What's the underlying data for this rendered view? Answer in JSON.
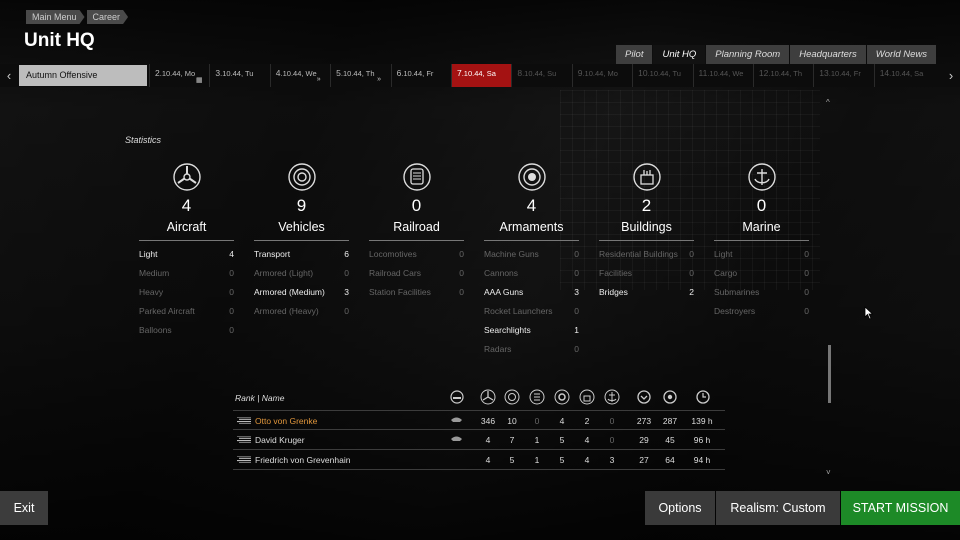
{
  "breadcrumb": [
    "Main Menu",
    "Career"
  ],
  "page_title": "Unit HQ",
  "tabs": [
    "Pilot",
    "Unit HQ",
    "Planning Room",
    "Headquarters",
    "World News"
  ],
  "active_tab": "Unit HQ",
  "timeline": {
    "campaign": "Autumn Offensive",
    "days": [
      {
        "num": "2",
        "label": ".10.44, Mo",
        "state": "normal",
        "glyph": "▦"
      },
      {
        "num": "3",
        "label": ".10.44, Tu",
        "state": "normal",
        "glyph": ""
      },
      {
        "num": "4",
        "label": ".10.44, We",
        "state": "normal",
        "glyph": "»"
      },
      {
        "num": "5",
        "label": ".10.44, Th",
        "state": "normal",
        "glyph": "»"
      },
      {
        "num": "6",
        "label": ".10.44, Fr",
        "state": "normal",
        "glyph": ""
      },
      {
        "num": "7",
        "label": ".10.44, Sa",
        "state": "current",
        "glyph": ""
      },
      {
        "num": "8",
        "label": ".10.44, Su",
        "state": "dim",
        "glyph": ""
      },
      {
        "num": "9",
        "label": ".10.44, Mo",
        "state": "dim",
        "glyph": ""
      },
      {
        "num": "10",
        "label": ".10.44, Tu",
        "state": "dim",
        "glyph": ""
      },
      {
        "num": "11",
        "label": ".10.44, We",
        "state": "dim",
        "glyph": ""
      },
      {
        "num": "12",
        "label": ".10.44, Th",
        "state": "dim",
        "glyph": ""
      },
      {
        "num": "13",
        "label": ".10.44, Fr",
        "state": "dim",
        "glyph": ""
      },
      {
        "num": "14",
        "label": ".10.44, Sa",
        "state": "dim",
        "glyph": ""
      }
    ]
  },
  "statistics": {
    "title": "Statistics",
    "categories": [
      {
        "name": "Aircraft",
        "count": "4",
        "icon": "propeller-icon",
        "rows": [
          {
            "label": "Light",
            "value": "4",
            "on": true
          },
          {
            "label": "Medium",
            "value": "0",
            "on": false
          },
          {
            "label": "Heavy",
            "value": "0",
            "on": false
          },
          {
            "label": "Parked Aircraft",
            "value": "0",
            "on": false
          },
          {
            "label": "Balloons",
            "value": "0",
            "on": false
          }
        ]
      },
      {
        "name": "Vehicles",
        "count": "9",
        "icon": "wheel-icon",
        "rows": [
          {
            "label": "Transport",
            "value": "6",
            "on": true
          },
          {
            "label": "Armored (Light)",
            "value": "0",
            "on": false
          },
          {
            "label": "Armored (Medium)",
            "value": "3",
            "on": true
          },
          {
            "label": "Armored (Heavy)",
            "value": "0",
            "on": false
          }
        ]
      },
      {
        "name": "Railroad",
        "count": "0",
        "icon": "train-icon",
        "rows": [
          {
            "label": "Locomotives",
            "value": "0",
            "on": false
          },
          {
            "label": "Railroad Cars",
            "value": "0",
            "on": false
          },
          {
            "label": "Station Facilities",
            "value": "0",
            "on": false
          }
        ]
      },
      {
        "name": "Armaments",
        "count": "4",
        "icon": "gun-icon",
        "rows": [
          {
            "label": "Machine Guns",
            "value": "0",
            "on": false
          },
          {
            "label": "Cannons",
            "value": "0",
            "on": false
          },
          {
            "label": "AAA Guns",
            "value": "3",
            "on": true
          },
          {
            "label": "Rocket Launchers",
            "value": "0",
            "on": false
          },
          {
            "label": "Searchlights",
            "value": "1",
            "on": true
          },
          {
            "label": "Radars",
            "value": "0",
            "on": false
          }
        ]
      },
      {
        "name": "Buildings",
        "count": "2",
        "icon": "factory-icon",
        "rows": [
          {
            "label": "Residential Buildings",
            "value": "0",
            "on": false
          },
          {
            "label": "Facilities",
            "value": "0",
            "on": false
          },
          {
            "label": "Bridges",
            "value": "2",
            "on": true
          }
        ]
      },
      {
        "name": "Marine",
        "count": "0",
        "icon": "anchor-icon",
        "rows": [
          {
            "label": "Light",
            "value": "0",
            "on": false
          },
          {
            "label": "Cargo",
            "value": "0",
            "on": false
          },
          {
            "label": "Submarines",
            "value": "0",
            "on": false
          },
          {
            "label": "Destroyers",
            "value": "0",
            "on": false
          }
        ]
      }
    ]
  },
  "roster": {
    "header": "Rank | Name",
    "pilots": [
      {
        "name": "Otto von Grenke",
        "highlight": true,
        "values": [
          "346",
          "10",
          "0",
          "4",
          "2",
          "0",
          "273",
          "287",
          "139 h"
        ]
      },
      {
        "name": "David Kruger",
        "highlight": false,
        "values": [
          "4",
          "7",
          "1",
          "5",
          "4",
          "0",
          "29",
          "45",
          "96 h"
        ]
      },
      {
        "name": "Friedrich von Grevenhain",
        "highlight": false,
        "values": [
          "4",
          "5",
          "1",
          "5",
          "4",
          "3",
          "27",
          "64",
          "94 h"
        ]
      }
    ]
  },
  "buttons": {
    "exit": "Exit",
    "options": "Options",
    "realism": "Realism: Custom",
    "start": "START MISSION"
  },
  "colors": {
    "start_button": "#1d8a27",
    "current_day": "#a41212",
    "highlight_name": "#e0963c"
  }
}
